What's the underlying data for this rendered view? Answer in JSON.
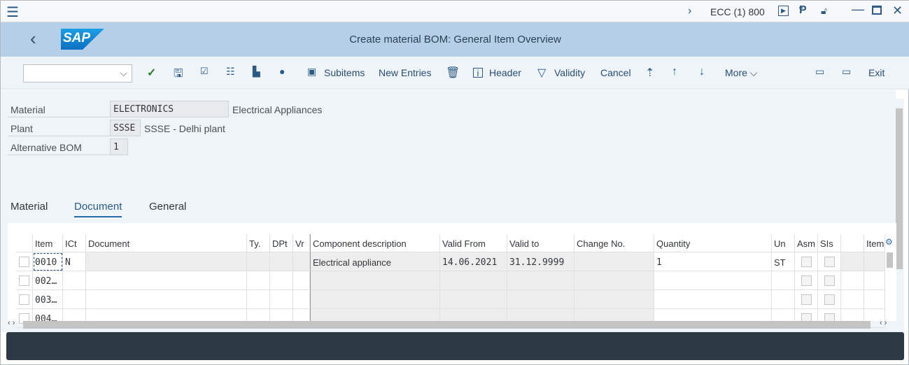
{
  "topbar": {
    "system": "ECC (1) 800"
  },
  "title": "Create material BOM: General Item Overview",
  "logo": "SAP",
  "toolbar": {
    "command_value": "",
    "subitems": "Subitems",
    "new_entries": "New Entries",
    "header": "Header",
    "validity": "Validity",
    "cancel": "Cancel",
    "more": "More",
    "exit": "Exit"
  },
  "header_fields": {
    "material_label": "Material",
    "material_value": "ELECTRONICS",
    "material_desc": "Electrical Appliances",
    "plant_label": "Plant",
    "plant_value": "SSSE",
    "plant_desc": "SSSE - Delhi plant",
    "altbom_label": "Alternative BOM",
    "altbom_value": "1"
  },
  "tabs": [
    {
      "label": "Material"
    },
    {
      "label": "Document",
      "active": true
    },
    {
      "label": "General"
    }
  ],
  "table": {
    "columns": [
      "Item",
      "ICt",
      "Document",
      "Ty.",
      "DPt",
      "Vr",
      "Component description",
      "Valid From",
      "Valid to",
      "Change No.",
      "Quantity",
      "Un",
      "Asm",
      "SIs",
      "",
      "Item"
    ],
    "rows": [
      {
        "item": "0010",
        "ict": "N",
        "document": "",
        "ty": "",
        "dpt": "",
        "vr": "",
        "desc": "Electrical appliance",
        "from": "14.06.2021",
        "to": "31.12.9999",
        "change": "",
        "qty": "1",
        "un": "ST"
      },
      {
        "item": "002…",
        "ict": "",
        "document": "",
        "ty": "",
        "dpt": "",
        "vr": "",
        "desc": "",
        "from": "",
        "to": "",
        "change": "",
        "qty": "",
        "un": ""
      },
      {
        "item": "003…",
        "ict": "",
        "document": "",
        "ty": "",
        "dpt": "",
        "vr": "",
        "desc": "",
        "from": "",
        "to": "",
        "change": "",
        "qty": "",
        "un": ""
      },
      {
        "item": "004…",
        "ict": "",
        "document": "",
        "ty": "",
        "dpt": "",
        "vr": "",
        "desc": "",
        "from": "",
        "to": "",
        "change": "",
        "qty": "",
        "un": ""
      }
    ]
  }
}
